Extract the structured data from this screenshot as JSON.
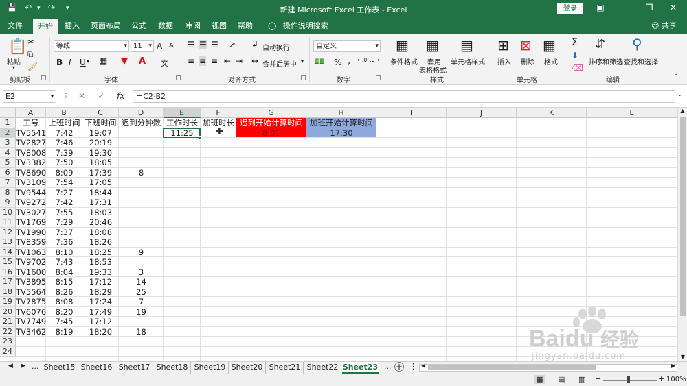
{
  "app": {
    "title": "新建 Microsoft Excel 工作表 - Excel",
    "login": "登录",
    "share": "共享",
    "tell_me": "操作说明搜索"
  },
  "tabs": [
    "文件",
    "开始",
    "插入",
    "页面布局",
    "公式",
    "数据",
    "审阅",
    "视图",
    "帮助"
  ],
  "ribbon": {
    "clipboard": {
      "paste": "粘贴",
      "label": "剪贴板"
    },
    "font": {
      "name": "等线",
      "size": "11",
      "label": "字体",
      "bold": "B",
      "italic": "I",
      "underline": "U",
      "grow": "A",
      "shrink": "A",
      "phonetic": "文"
    },
    "alignment": {
      "wrap": "自动换行",
      "merge": "合并后居中",
      "label": "对齐方式"
    },
    "number": {
      "format": "自定义",
      "label": "数字",
      "percent": "%",
      "comma": ","
    },
    "styles": {
      "conditional": "条件格式",
      "table_line1": "套用",
      "table_line2": "表格格式",
      "cell_styles": "单元格样式",
      "label": "样式"
    },
    "cells": {
      "insert": "插入",
      "delete": "删除",
      "format": "格式",
      "label": "单元格"
    },
    "editing": {
      "sort": "排序和筛选",
      "find": "查找和选择",
      "label": "编辑",
      "sum": "Σ"
    }
  },
  "formula_bar": {
    "name_box": "E2",
    "fx": "fx",
    "formula": "=C2-B2"
  },
  "columns": [
    "A",
    "B",
    "C",
    "D",
    "E",
    "F",
    "G",
    "H",
    "I",
    "J",
    "K",
    "L"
  ],
  "rows": [
    "1",
    "2",
    "3",
    "4",
    "5",
    "6",
    "7",
    "8",
    "9",
    "10",
    "11",
    "12",
    "13",
    "14",
    "15",
    "16",
    "17",
    "18",
    "19",
    "20",
    "21",
    "22",
    "23",
    "24"
  ],
  "headers": [
    "工号",
    "上班时间",
    "下班时间",
    "迟到分钟数",
    "工作时长",
    "加班时长",
    "迟到开始计算时间",
    "加班开始计算时间"
  ],
  "table_rows": [
    [
      "TV5541",
      "7:42",
      "19:07",
      ""
    ],
    [
      "TV2827",
      "7:46",
      "20:19",
      ""
    ],
    [
      "TV8008",
      "7:39",
      "19:30",
      ""
    ],
    [
      "TV3382",
      "7:50",
      "18:05",
      ""
    ],
    [
      "TV8690",
      "8:09",
      "17:39",
      "8"
    ],
    [
      "TV3109",
      "7:54",
      "17:05",
      ""
    ],
    [
      "TV9544",
      "7:27",
      "18:44",
      ""
    ],
    [
      "TV9272",
      "7:42",
      "17:31",
      ""
    ],
    [
      "TV3027",
      "7:55",
      "18:03",
      ""
    ],
    [
      "TV1769",
      "7:29",
      "20:46",
      ""
    ],
    [
      "TV1990",
      "7:37",
      "18:08",
      ""
    ],
    [
      "TV8359",
      "7:36",
      "18:26",
      ""
    ],
    [
      "TV1063",
      "8:10",
      "18:25",
      "9"
    ],
    [
      "TV9702",
      "7:43",
      "18:53",
      ""
    ],
    [
      "TV1600",
      "8:04",
      "19:33",
      "3"
    ],
    [
      "TV3895",
      "8:15",
      "17:12",
      "14"
    ],
    [
      "TV5564",
      "8:26",
      "18:29",
      "25"
    ],
    [
      "TV7875",
      "8:08",
      "17:24",
      "7"
    ],
    [
      "TV6076",
      "8:20",
      "17:49",
      "19"
    ],
    [
      "TV7749",
      "7:45",
      "17:12",
      ""
    ],
    [
      "TV3462",
      "8:19",
      "18:20",
      "18"
    ]
  ],
  "cells": {
    "E2": "11:25",
    "G2": "8:01",
    "H2": "17:30"
  },
  "colors": {
    "excel_green": "#217346",
    "g1_fill": "#ff0000",
    "h1_fill": "#8ea9db"
  },
  "sheets": [
    "Sheet15",
    "Sheet16",
    "Sheet17",
    "Sheet18",
    "Sheet19",
    "Sheet20",
    "Sheet21",
    "Sheet22",
    "Sheet23"
  ],
  "sheet_more": "...",
  "zoom": "100%",
  "watermark": {
    "brand": "Bai",
    "brand2": "du",
    "cn": "经验",
    "url": "jingyan.baidu.com"
  }
}
